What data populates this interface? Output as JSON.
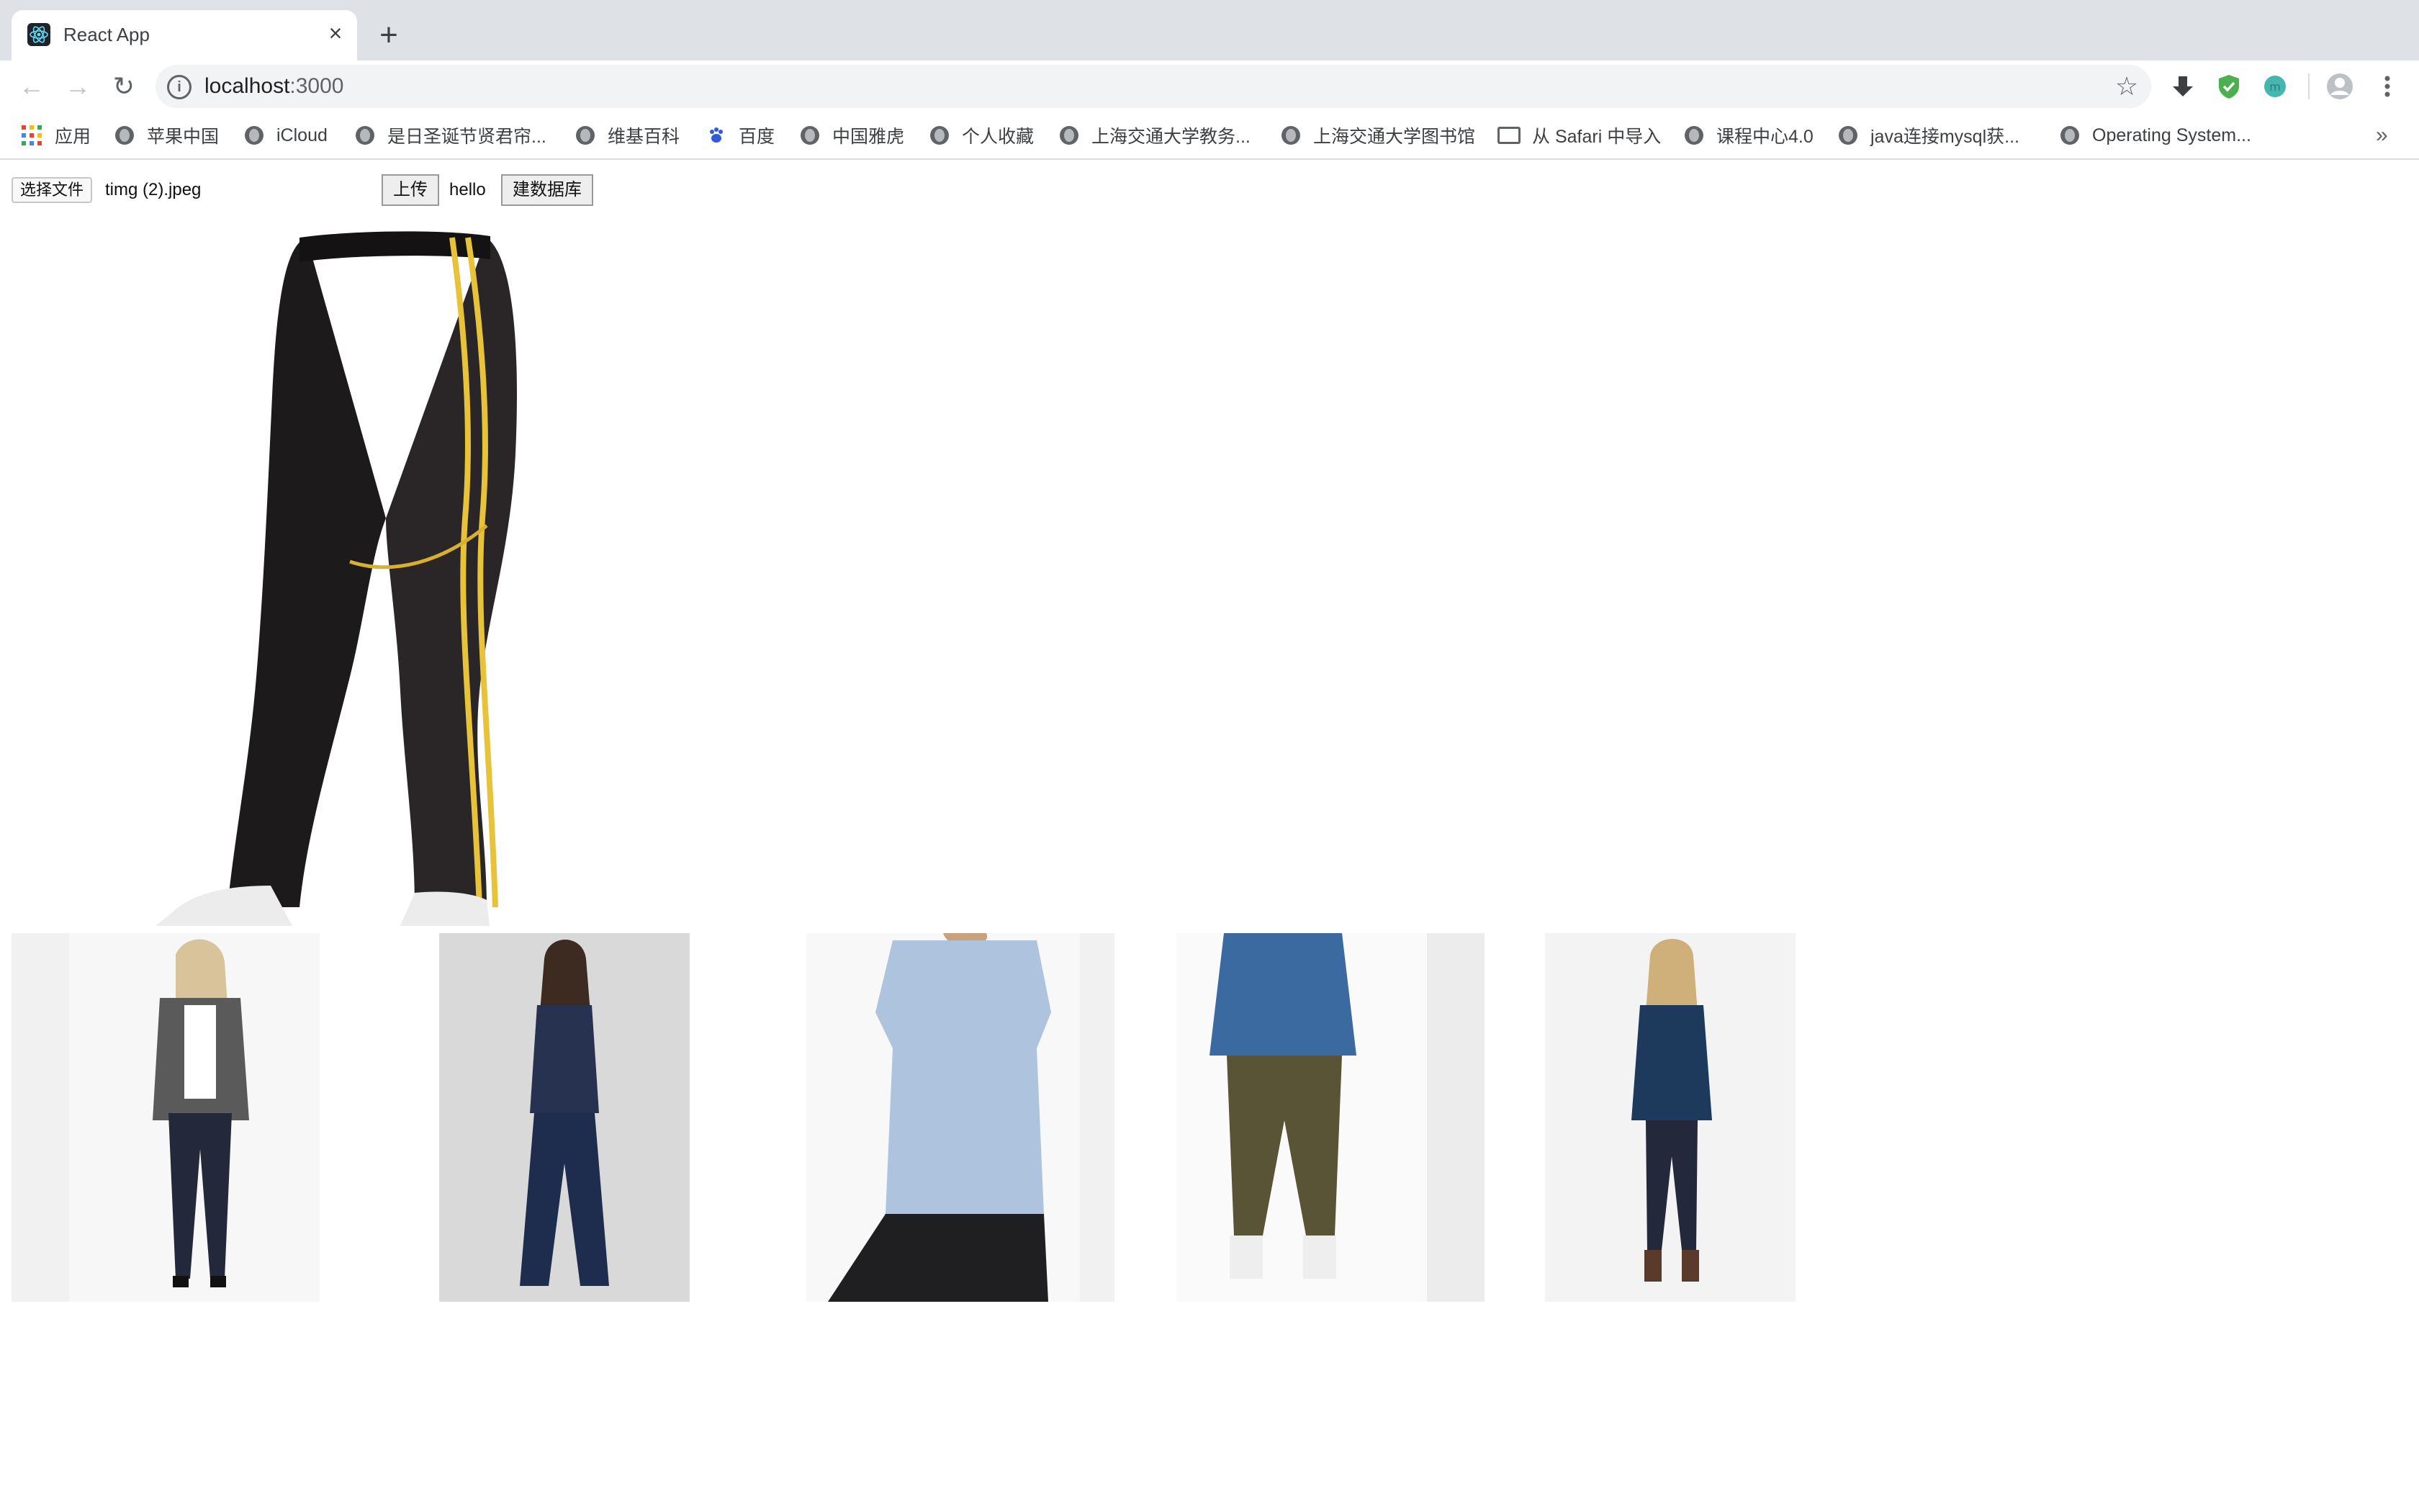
{
  "browser": {
    "tab": {
      "title": "React App",
      "close_glyph": "×",
      "favicon": "react-logo-icon"
    },
    "new_tab_glyph": "+",
    "nav": {
      "back": "←",
      "forward": "→",
      "reload": "↻"
    },
    "address": {
      "host": "localhost",
      "port": ":3000",
      "info_glyph": "i",
      "star_glyph": "☆"
    },
    "extensions": [
      "download-icon",
      "shield-check-icon",
      "extension-circle-icon",
      "profile-avatar-icon",
      "kebab-menu-icon"
    ],
    "bookmarks": [
      {
        "label": "应用",
        "icon": "apps-grid-icon"
      },
      {
        "label": "苹果中国",
        "icon": "globe-icon"
      },
      {
        "label": "iCloud",
        "icon": "globe-icon"
      },
      {
        "label": "是日圣诞节贤君帘...",
        "icon": "globe-icon"
      },
      {
        "label": "维基百科",
        "icon": "globe-icon"
      },
      {
        "label": "百度",
        "icon": "baidu-paw-icon"
      },
      {
        "label": "中国雅虎",
        "icon": "globe-icon"
      },
      {
        "label": "个人收藏",
        "icon": "globe-icon"
      },
      {
        "label": "上海交通大学教务...",
        "icon": "globe-icon"
      },
      {
        "label": "上海交通大学图书馆",
        "icon": "globe-icon"
      },
      {
        "label": "从 Safari 中导入",
        "icon": "folder-icon"
      },
      {
        "label": "课程中心4.0",
        "icon": "globe-icon"
      },
      {
        "label": "java连接mysql获...",
        "icon": "globe-icon"
      },
      {
        "label": "Operating System...",
        "icon": "globe-icon"
      }
    ],
    "bookmarks_more": "»"
  },
  "page": {
    "file_input": {
      "button_label": "选择文件",
      "file_name": "timg (2).jpeg"
    },
    "upload_button": "上传",
    "hello_text": "hello",
    "build_db_button": "建数据库",
    "main_image": "uploaded-track-pants-image",
    "results": [
      {
        "name": "result-image-1"
      },
      {
        "name": "result-image-2"
      },
      {
        "name": "result-image-3"
      },
      {
        "name": "result-image-4"
      },
      {
        "name": "result-image-5"
      }
    ]
  },
  "colors": {
    "tabstrip": "#dee1e6",
    "omnibox": "#f1f3f4",
    "accent_yellow": "#e8c238"
  }
}
